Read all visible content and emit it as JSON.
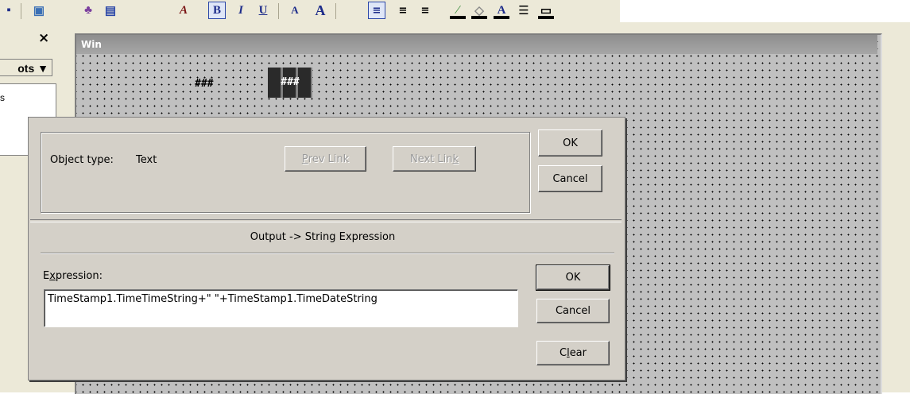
{
  "toolbar": {
    "buttons": [
      "bold",
      "italic",
      "underline",
      "font-size-small",
      "font-size-large",
      "align-left",
      "align-center",
      "align-right",
      "line-color",
      "fill-color",
      "text-color",
      "line-style",
      "border-style"
    ],
    "labels": {
      "bold": "B",
      "italic": "I",
      "underline": "U",
      "small_a": "A",
      "large_a": "A"
    }
  },
  "left_panel": {
    "close_symbol": "×",
    "combo_label": "ots ▼",
    "list_item": "s"
  },
  "canvas": {
    "window_title": "Win",
    "field1": "###",
    "field2_selected": "###"
  },
  "dialog": {
    "object_type_label": "Object type:",
    "object_type_value": "Text",
    "prev_link": {
      "pre": "",
      "mnemonic": "P",
      "post": "rev Link"
    },
    "next_link": {
      "pre": "Next Lin",
      "mnemonic": "k",
      "post": ""
    },
    "ok_top": "OK",
    "cancel_top": "Cancel",
    "panel_title": "Output -> String Expression",
    "expression_label": {
      "pre": "E",
      "mnemonic": "x",
      "post": "pression:"
    },
    "expression_value": "TimeStamp1.TimeTimeString+\" \"+TimeStamp1.TimeDateString",
    "ok": "OK",
    "cancel": "Cancel",
    "clear": {
      "pre": "C",
      "mnemonic": "l",
      "post": "ear"
    }
  },
  "colors": {
    "dialog_bg": "#d4d0c8",
    "canvas_bg": "#c0c0c0",
    "title_bar": "#9a9a9a",
    "toolbar_bg": "#ece9d8"
  }
}
